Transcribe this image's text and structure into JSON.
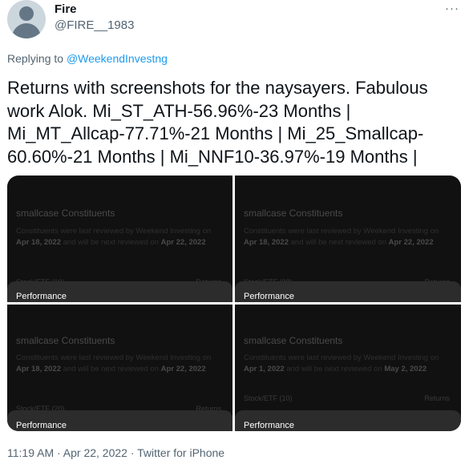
{
  "author": {
    "name": "Fire",
    "handle": "@FIRE__1983",
    "more_icon": "more-horizontal-icon"
  },
  "reply": {
    "prefix": "Replying to",
    "mention": "@WeekendInvestng"
  },
  "tweet": {
    "lines": [
      "Returns with screenshots for the naysayers. Fabulous",
      "work Alok. Mi_ST_ATH-56.96%-23 Months |",
      "Mi_MT_Allcap-77.71%-21 Months | Mi_25_Smallcap-",
      "60.60%-21 Months | Mi_NNF10-36.97%-19 Months |"
    ]
  },
  "media": [
    {
      "title": "smallcase Constituents",
      "desc_prefix": "Constituents were last reviewed by Weekend Investing on",
      "last_date": "Apr 18, 2022",
      "desc_mid": "and will be next reviewed on",
      "next_date": "Apr 22, 2022",
      "stock_label": "Stock/ETF (10)",
      "returns_label": "Returns",
      "performance_label": "Performance"
    },
    {
      "title": "smallcase Constituents",
      "desc_prefix": "Constituents were last reviewed by Weekend Investing on",
      "last_date": "Apr 18, 2022",
      "desc_mid": "and will be next reviewed on",
      "next_date": "Apr 22, 2022",
      "stock_label": "Stock/ETF (08)",
      "returns_label": "Returns",
      "performance_label": "Performance"
    },
    {
      "title": "smallcase Constituents",
      "desc_prefix": "Constituents were last reviewed by Weekend Investing on",
      "last_date": "Apr 18, 2022",
      "desc_mid": "and will be next reviewed on",
      "next_date": "Apr 22, 2022",
      "stock_label": "Stock/ETF (20)",
      "returns_label": "Returns",
      "performance_label": "Performance"
    },
    {
      "title": "smallcase Constituents",
      "desc_prefix": "Constituents were last reviewed by Weekend Investing on",
      "last_date": "Apr 1, 2022",
      "desc_mid": "and will be next reviewed on",
      "next_date": "May 2, 2022",
      "stock_label": "Stock/ETF (10)",
      "returns_label": "Returns",
      "performance_label": "Performance"
    }
  ],
  "footer": {
    "timestamp": "11:19 AM · Apr 22, 2022 · Twitter for iPhone"
  },
  "colors": {
    "link": "#1d9bf0",
    "secondary_text": "#536471",
    "tile_background": "#111111"
  }
}
